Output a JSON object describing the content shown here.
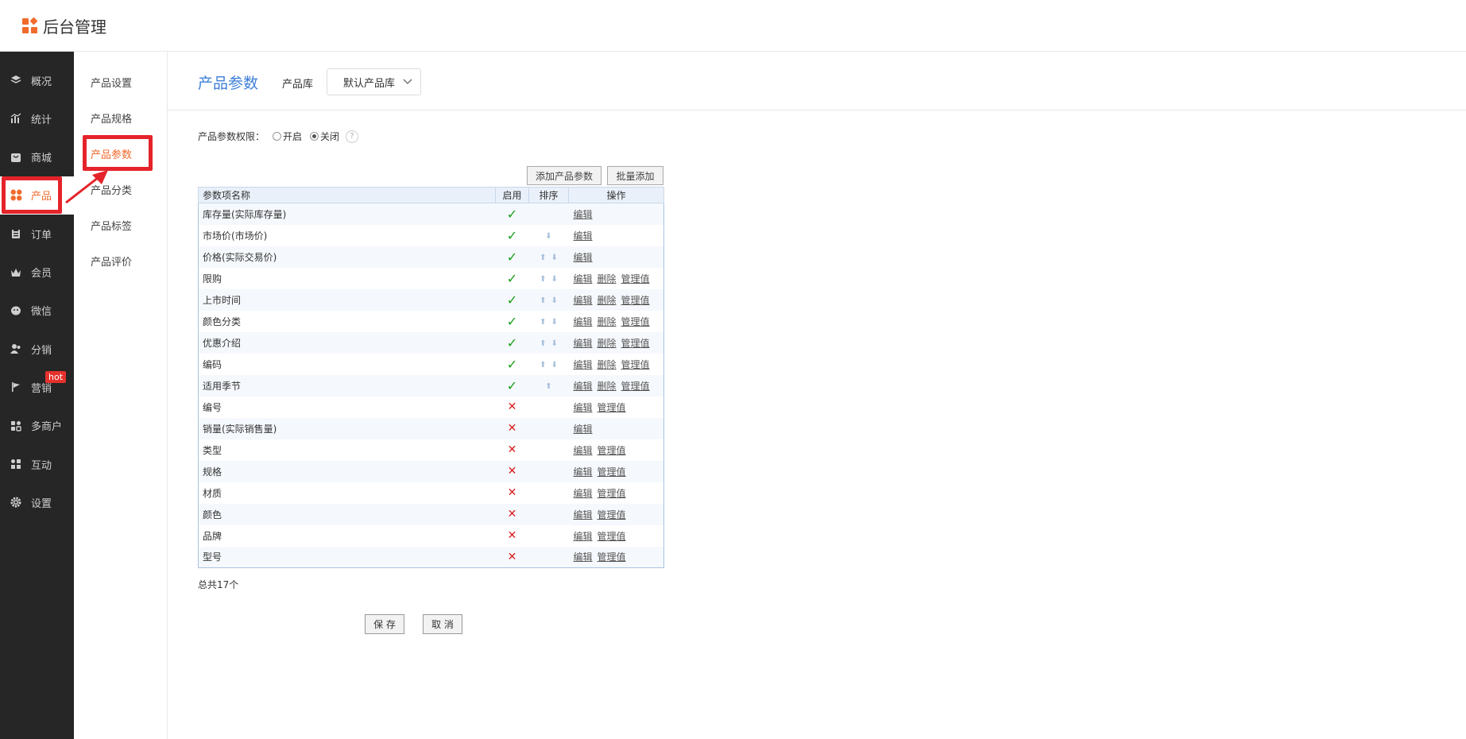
{
  "app": {
    "title": "后台管理"
  },
  "sidebar": {
    "items": [
      {
        "label": "概况",
        "icon": "layers-icon"
      },
      {
        "label": "统计",
        "icon": "chart-icon"
      },
      {
        "label": "商城",
        "icon": "store-icon"
      },
      {
        "label": "产品",
        "icon": "apps-icon",
        "active": true
      },
      {
        "label": "订单",
        "icon": "clipboard-icon"
      },
      {
        "label": "会员",
        "icon": "crown-icon"
      },
      {
        "label": "微信",
        "icon": "wechat-icon"
      },
      {
        "label": "分销",
        "icon": "users-icon"
      },
      {
        "label": "营销",
        "icon": "flag-icon",
        "badge": "hot"
      },
      {
        "label": "多商户",
        "icon": "shop-icon"
      },
      {
        "label": "互动",
        "icon": "grid-icon"
      },
      {
        "label": "设置",
        "icon": "gear-icon"
      }
    ]
  },
  "subnav": {
    "items": [
      "产品设置",
      "产品规格",
      "产品参数",
      "产品分类",
      "产品标签",
      "产品评价"
    ],
    "active": "产品参数"
  },
  "page": {
    "title": "产品参数",
    "library_label": "产品库",
    "library_value": "默认产品库"
  },
  "permission": {
    "label": "产品参数权限：",
    "on": "开启",
    "off": "关闭",
    "selected": "关闭",
    "help": "?"
  },
  "toolbar": {
    "add_label": "添加产品参数",
    "batch_label": "批量添加"
  },
  "table": {
    "headers": [
      "参数项名称",
      "启用",
      "排序",
      "操作"
    ],
    "rows": [
      {
        "name": "库存量(实际库存量)",
        "enabled": true,
        "sort": [],
        "ops": [
          "编辑"
        ]
      },
      {
        "name": "市场价(市场价)",
        "enabled": true,
        "sort": [
          "down"
        ],
        "ops": [
          "编辑"
        ]
      },
      {
        "name": "价格(实际交易价)",
        "enabled": true,
        "sort": [
          "up",
          "down"
        ],
        "ops": [
          "编辑"
        ]
      },
      {
        "name": "限购",
        "enabled": true,
        "sort": [
          "up",
          "down"
        ],
        "ops": [
          "编辑",
          "删除",
          "管理值"
        ]
      },
      {
        "name": "上市时间",
        "enabled": true,
        "sort": [
          "up",
          "down"
        ],
        "ops": [
          "编辑",
          "删除",
          "管理值"
        ]
      },
      {
        "name": "颜色分类",
        "enabled": true,
        "sort": [
          "up",
          "down"
        ],
        "ops": [
          "编辑",
          "删除",
          "管理值"
        ]
      },
      {
        "name": "优惠介绍",
        "enabled": true,
        "sort": [
          "up",
          "down"
        ],
        "ops": [
          "编辑",
          "删除",
          "管理值"
        ]
      },
      {
        "name": "编码",
        "enabled": true,
        "sort": [
          "up",
          "down"
        ],
        "ops": [
          "编辑",
          "删除",
          "管理值"
        ]
      },
      {
        "name": "适用季节",
        "enabled": true,
        "sort": [
          "up"
        ],
        "ops": [
          "编辑",
          "删除",
          "管理值"
        ]
      },
      {
        "name": "编号",
        "enabled": false,
        "sort": [],
        "ops": [
          "编辑",
          "管理值"
        ]
      },
      {
        "name": "销量(实际销售量)",
        "enabled": false,
        "sort": [],
        "ops": [
          "编辑"
        ]
      },
      {
        "name": "类型",
        "enabled": false,
        "sort": [],
        "ops": [
          "编辑",
          "管理值"
        ]
      },
      {
        "name": "规格",
        "enabled": false,
        "sort": [],
        "ops": [
          "编辑",
          "管理值"
        ]
      },
      {
        "name": "材质",
        "enabled": false,
        "sort": [],
        "ops": [
          "编辑",
          "管理值"
        ]
      },
      {
        "name": "颜色",
        "enabled": false,
        "sort": [],
        "ops": [
          "编辑",
          "管理值"
        ]
      },
      {
        "name": "品牌",
        "enabled": false,
        "sort": [],
        "ops": [
          "编辑",
          "管理值"
        ]
      },
      {
        "name": "型号",
        "enabled": false,
        "sort": [],
        "ops": [
          "编辑",
          "管理值"
        ]
      }
    ]
  },
  "footer": {
    "total": "总共17个",
    "save_label": "保 存",
    "cancel_label": "取 消"
  }
}
